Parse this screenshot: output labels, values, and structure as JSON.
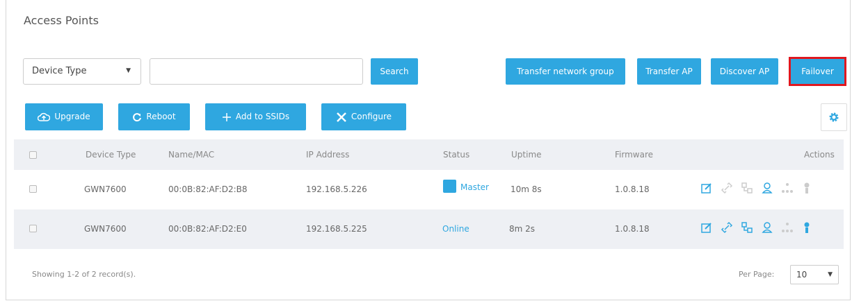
{
  "page": {
    "title": "Access Points"
  },
  "filter": {
    "device_type_selected": "Device Type",
    "search_value": "",
    "search_label": "Search"
  },
  "top_buttons": {
    "transfer_network_group": "Transfer network group",
    "transfer_ap": "Transfer AP",
    "discover_ap": "Discover AP",
    "failover": "Failover"
  },
  "actions": {
    "upgrade": "Upgrade",
    "reboot": "Reboot",
    "add_to_ssids": "Add to SSIDs",
    "configure": "Configure"
  },
  "table": {
    "headers": {
      "device_type": "Device Type",
      "name_mac": "Name/MAC",
      "ip_address": "IP Address",
      "status": "Status",
      "uptime": "Uptime",
      "firmware": "Firmware",
      "actions": "Actions"
    },
    "rows": [
      {
        "device_type": "GWN7600",
        "name_mac": "00:0B:82:AF:D2:B8",
        "ip": "192.168.5.226",
        "status": "Master",
        "uptime": "10m 8s",
        "firmware": "1.0.8.18"
      },
      {
        "device_type": "GWN7600",
        "name_mac": "00:0B:82:AF:D2:E0",
        "ip": "192.168.5.225",
        "status": "Online",
        "uptime": "8m 2s",
        "firmware": "1.0.8.18"
      }
    ]
  },
  "footer": {
    "records": "Showing 1-2 of 2 record(s).",
    "per_page_label": "Per Page:",
    "per_page_value": "10"
  },
  "colors": {
    "accent": "#2fa7e0",
    "highlight": "#e0171f",
    "row_alt": "#eef0f4"
  }
}
